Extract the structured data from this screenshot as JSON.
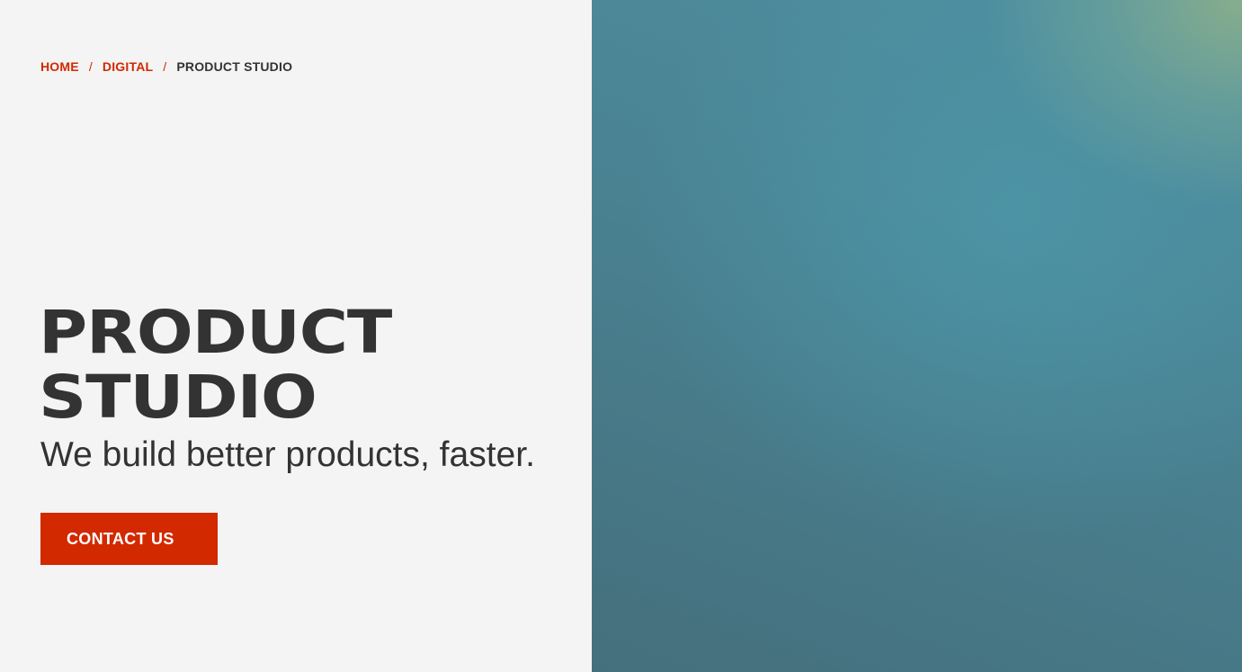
{
  "breadcrumb": {
    "items": [
      {
        "label": "HOME"
      },
      {
        "label": "DIGITAL"
      }
    ],
    "separator": "/",
    "current": "PRODUCT STUDIO"
  },
  "hero": {
    "title_line1": "PRODUCT",
    "title_line2": "STUDIO",
    "subtitle": "We build better products, faster.",
    "cta_label": "CONTACT US"
  },
  "colors": {
    "accent": "#d22900",
    "text": "#333333",
    "background": "#f4f4f4",
    "image_teal": "#4a8494"
  }
}
